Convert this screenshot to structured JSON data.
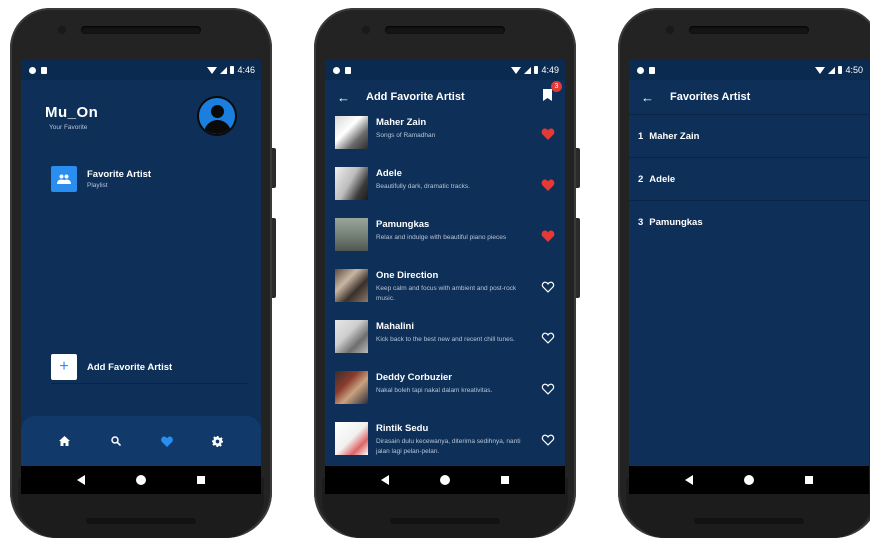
{
  "colors": {
    "screen_bg": "#0d2f58",
    "accent_blue": "#2a8ef0",
    "heart_red": "#e53935",
    "tabbar_bg": "#113a6b"
  },
  "phone1": {
    "status": {
      "time": "4:46"
    },
    "app_title": "Mu_On",
    "app_subtitle": "Your Favorite",
    "menu": [
      {
        "label": "Favorite Artist",
        "sub": "Playlist",
        "icon": "group-icon"
      }
    ],
    "add_button": {
      "label": "Add Favorite Artist",
      "icon": "plus-icon"
    },
    "tabs": [
      {
        "icon": "home-icon",
        "active": false
      },
      {
        "icon": "search-icon",
        "active": false
      },
      {
        "icon": "heart-icon",
        "active": true
      },
      {
        "icon": "settings-icon",
        "active": false
      }
    ]
  },
  "phone2": {
    "status": {
      "time": "4:49"
    },
    "title": "Add Favorite Artist",
    "badge_count": "3",
    "artists": [
      {
        "name": "Maher Zain",
        "desc": "Songs of Ramadhan",
        "favorite": true
      },
      {
        "name": "Adele",
        "desc": "Beautifully dark, dramatic tracks.",
        "favorite": true
      },
      {
        "name": "Pamungkas",
        "desc": "Relax and indulge with beautiful piano pieces",
        "favorite": true
      },
      {
        "name": "One Direction",
        "desc": "Keep calm and focus with ambient and post-rock music.",
        "favorite": false
      },
      {
        "name": "Mahalini",
        "desc": "Kick back to the best new and recent chill tunes.",
        "favorite": false
      },
      {
        "name": "Deddy Corbuzier",
        "desc": "Nakal boleh tapi nakal dalam kreativitas.",
        "favorite": false
      },
      {
        "name": "Rintik Sedu",
        "desc": "Dirasain dulu kecewanya, diterima sedihnya, nanti jalan lagi pelan-pelan.",
        "favorite": false
      }
    ]
  },
  "phone3": {
    "status": {
      "time": "4:50"
    },
    "title": "Favorites Artist",
    "favorites": [
      {
        "num": "1",
        "name": "Maher Zain"
      },
      {
        "num": "2",
        "name": "Adele"
      },
      {
        "num": "3",
        "name": "Pamungkas"
      }
    ]
  }
}
